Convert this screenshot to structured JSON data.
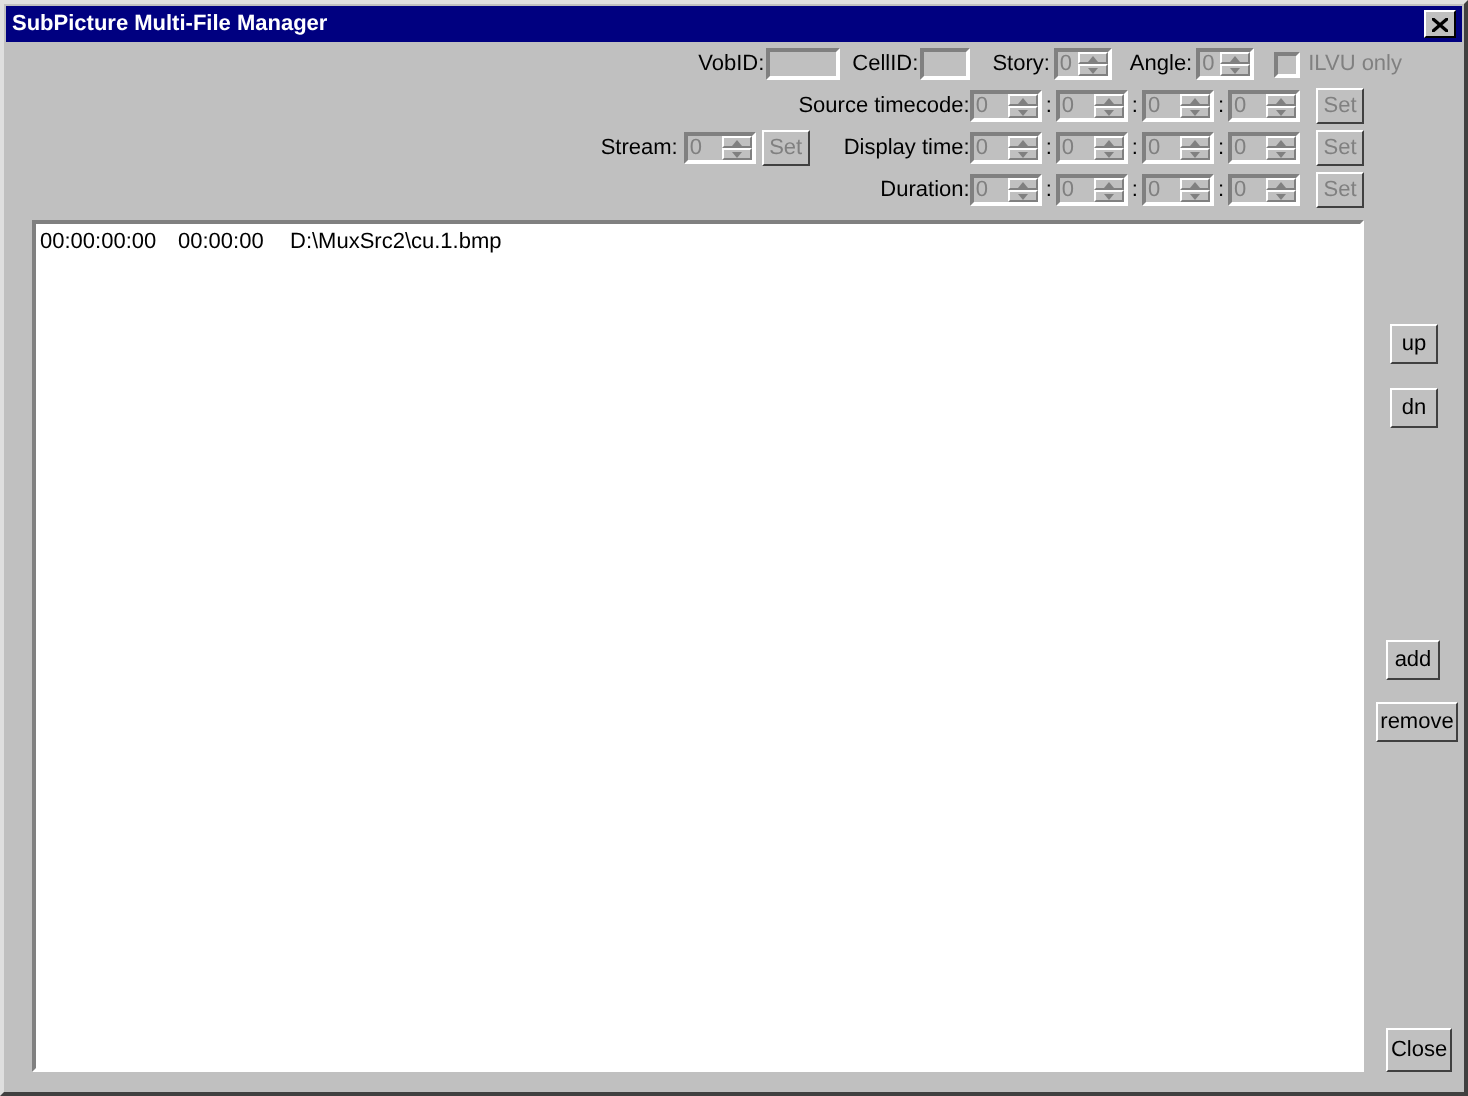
{
  "window": {
    "title": "SubPicture Multi-File Manager"
  },
  "top_row": {
    "vob_id": {
      "label": "VobID:"
    },
    "cell_id": {
      "label": "CellID:"
    },
    "story": {
      "label": "Story:",
      "value": "0",
      "disabled": true
    },
    "angle": {
      "label": "Angle:",
      "value": "0",
      "disabled": true
    },
    "ilvu": {
      "label": "ILVU only",
      "checked": false,
      "disabled": true
    }
  },
  "stream": {
    "label": "Stream:",
    "value": "0",
    "disabled": true,
    "set": {
      "label": "Set",
      "disabled": true
    }
  },
  "time_rows": [
    {
      "label": "Source timecode:",
      "fields": [
        {
          "value": "0",
          "disabled": true
        },
        {
          "value": "0",
          "disabled": true
        },
        {
          "value": "0",
          "disabled": true
        },
        {
          "value": "0",
          "disabled": true
        }
      ],
      "separators": [
        ":",
        ":",
        ":"
      ],
      "set": {
        "label": "Set",
        "disabled": true
      }
    },
    {
      "label": "Display time:",
      "fields": [
        {
          "value": "0",
          "disabled": true
        },
        {
          "value": "0",
          "disabled": true
        },
        {
          "value": "0",
          "disabled": true
        },
        {
          "value": "0",
          "disabled": true
        }
      ],
      "separators": [
        ":",
        ":",
        ":"
      ],
      "set": {
        "label": "Set",
        "disabled": true
      }
    },
    {
      "label": "Duration:",
      "fields": [
        {
          "value": "0",
          "disabled": true
        },
        {
          "value": "0",
          "disabled": true
        },
        {
          "value": "0",
          "disabled": true
        },
        {
          "value": "0",
          "disabled": true
        }
      ],
      "separators": [
        ":",
        ":",
        ":"
      ],
      "set": {
        "label": "Set",
        "disabled": true
      }
    }
  ],
  "file_list": {
    "rows": [
      {
        "cells": [
          "00:00:00:00",
          "00:00:00",
          "D:\\MuxSrc2\\cu.1.bmp"
        ]
      }
    ]
  },
  "side_buttons": [
    {
      "label": "up"
    },
    {
      "label": "dn"
    },
    {
      "label": "add"
    },
    {
      "label": "remove"
    }
  ],
  "close_button": {
    "label": "Close"
  }
}
